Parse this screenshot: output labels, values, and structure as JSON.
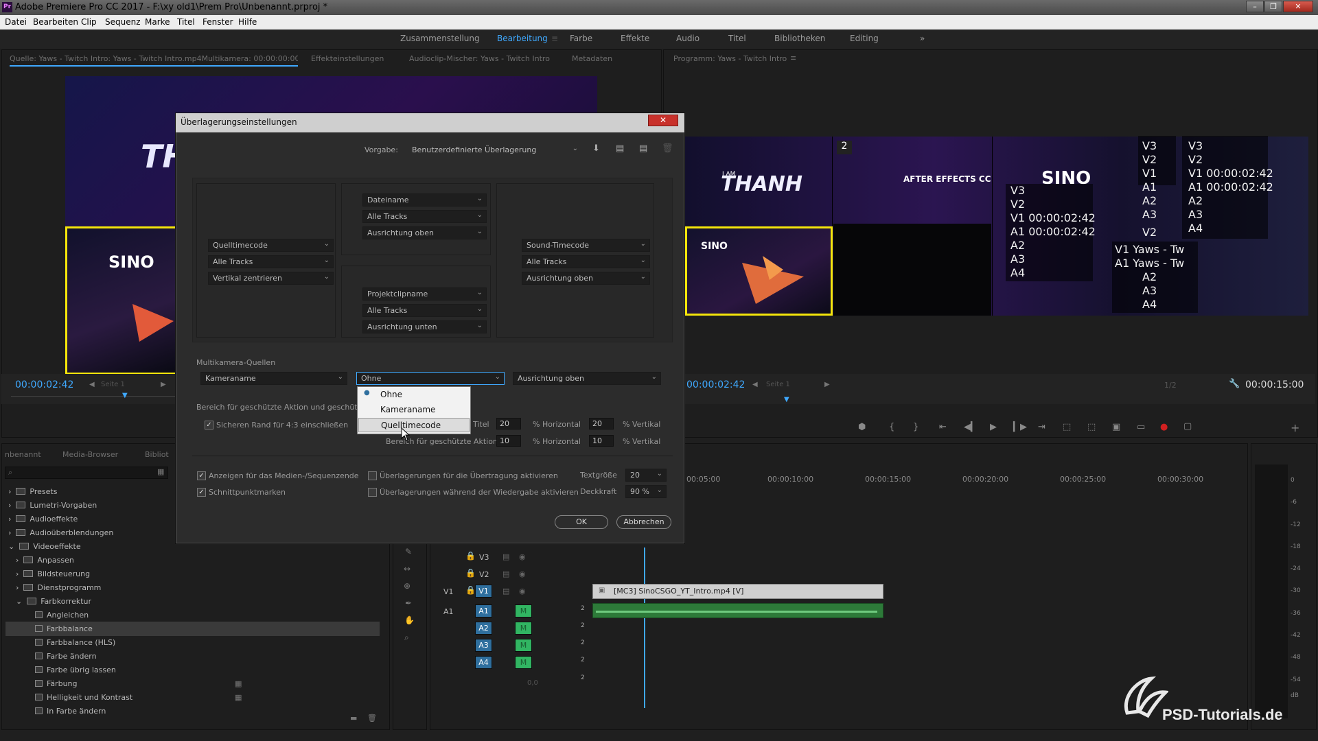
{
  "app": {
    "title": "Adobe Premiere Pro CC 2017 - F:\\xy old1\\Prem Pro\\Unbenannt.prproj *",
    "logo": "Pr"
  },
  "menu": [
    "Datei",
    "Bearbeiten",
    "Clip",
    "Sequenz",
    "Marke",
    "Titel",
    "Fenster",
    "Hilfe"
  ],
  "workspaces": [
    "Zusammenstellung",
    "Bearbeitung",
    "Farbe",
    "Effekte",
    "Audio",
    "Titel",
    "Bibliotheken",
    "Editing"
  ],
  "source_tabs": [
    "Quelle: Yaws - Twitch Intro: Yaws - Twitch Intro.mp4Multikamera: 00:00:00:00",
    "Effekteinstellungen",
    "Audioclip-Mischer: Yaws - Twitch Intro",
    "Metadaten"
  ],
  "program_tab": "Programm: Yaws - Twitch Intro",
  "source_timecode": "00:00:02:42",
  "source_page": "Seite 1",
  "program_timecode": "00:00:02:42",
  "program_page": "Seite 1",
  "program_zoom": "1/2",
  "program_duration": "00:00:15:00",
  "program_cam_number": "2",
  "program_overlay": {
    "col1": [
      "V3",
      "V2",
      "V1 00:00:02:42",
      "A1 00:00:02:42",
      "A2",
      "A3",
      "A4"
    ],
    "col2": [
      "V3",
      "V2",
      "V1",
      "A1",
      "A2",
      "A3",
      "V2",
      "V1 Yaws - Tw",
      "A1 Yaws - Tw",
      "A2",
      "A3",
      "A4"
    ],
    "col3": [
      "V3",
      "V2",
      "V1 00:00:02:42",
      "A1 00:00:02:42",
      "A2",
      "A3",
      "A4"
    ]
  },
  "video_texts": {
    "thanh_top": "I AM",
    "thanh": "THANH",
    "ae": "AFTER EFFECTS CC",
    "sino": "SINO",
    "th": "TH",
    "sino_source": "SINO"
  },
  "dialog": {
    "title": "Überlagerungseinstellungen",
    "close": "✕",
    "preset_label": "Vorgabe:",
    "preset_value": "Benutzerdefinierte Überlagerung",
    "top_center": [
      "Dateiname",
      "Alle Tracks",
      "Ausrichtung oben"
    ],
    "mid_left": [
      "Quelltimecode",
      "Alle Tracks",
      "Vertikal zentrieren"
    ],
    "mid_right": [
      "Sound-Timecode",
      "Alle Tracks",
      "Ausrichtung oben"
    ],
    "bottom_center": [
      "Projektclipname",
      "Alle Tracks",
      "Ausrichtung unten"
    ],
    "multicam_label": "Multikamera-Quellen",
    "multicam": [
      "Kameraname",
      "Ohne",
      "Ausrichtung oben"
    ],
    "dropdown_options": [
      "Ohne",
      "Kameraname",
      "Quelltimecode"
    ],
    "dropdown_selected": "Ohne",
    "dropdown_hover": "Quelltimecode",
    "safe_area_label": "Bereich für geschützte Aktion und geschützten",
    "safe_margin_label": "Sicheren Rand für 4:3 einschließen",
    "title_label": "Titel",
    "title_h": "20",
    "title_v": "20",
    "action_label": "Bereich für geschützte Aktion",
    "action_h": "10",
    "action_v": "10",
    "pct_h": "% Horizontal",
    "pct_v": "% Vertikal",
    "show_media_end": "Anzeigen für das Medien-/Sequenzende",
    "cut_marks": "Schnittpunktmarken",
    "enable_transmit": "Überlagerungen für die Übertragung aktivieren",
    "enable_playback": "Überlagerungen während der Wiedergabe aktivieren",
    "text_size_label": "Textgröße",
    "text_size": "20",
    "opacity_label": "Deckkraft",
    "opacity": "90 %",
    "ok": "OK",
    "cancel": "Abbrechen"
  },
  "project_tabs": [
    "nbenannt",
    "Media-Browser",
    "Bibliot"
  ],
  "effects_tree": [
    {
      "label": "Presets",
      "level": 0
    },
    {
      "label": "Lumetri-Vorgaben",
      "level": 0
    },
    {
      "label": "Audioeffekte",
      "level": 0
    },
    {
      "label": "Audioüberblendungen",
      "level": 0
    },
    {
      "label": "Videoeffekte",
      "level": 0
    },
    {
      "label": "Anpassen",
      "level": 1
    },
    {
      "label": "Bildsteuerung",
      "level": 1
    },
    {
      "label": "Dienstprogramm",
      "level": 1
    },
    {
      "label": "Farbkorrektur",
      "level": 1
    },
    {
      "label": "Angleichen",
      "level": 2
    },
    {
      "label": "Farbbalance",
      "level": 2
    },
    {
      "label": "Farbbalance (HLS)",
      "level": 2
    },
    {
      "label": "Farbe ändern",
      "level": 2
    },
    {
      "label": "Farbe übrig lassen",
      "level": 2
    },
    {
      "label": "Färbung",
      "level": 2
    },
    {
      "label": "Helligkeit und Kontrast",
      "level": 2
    },
    {
      "label": "In Farbe ändern",
      "level": 2
    }
  ],
  "timeline": {
    "ruler": [
      "00:05:00",
      "00:00:10:00",
      "00:00:15:00",
      "00:00:20:00",
      "00:00:25:00",
      "00:00:30:00"
    ],
    "video_tracks": [
      "V3",
      "V2",
      "V1"
    ],
    "audio_tracks": [
      "A1",
      "A2",
      "A3",
      "A4"
    ],
    "src_v": "V1",
    "src_a": "A1",
    "clip_video": "[MC3] SinoCSGO_YT_Intro.mp4 [V]",
    "mix_value": "0,0",
    "track_nums": [
      "2",
      "2",
      "2",
      "2",
      "2"
    ]
  },
  "meter_labels": [
    "0",
    "-6",
    "-12",
    "-18",
    "-24",
    "-30",
    "-36",
    "-42",
    "-48",
    "-54",
    "dB"
  ],
  "watermark": "PSD-Tutorials.de",
  "colors": {
    "accent": "#3fa9ff",
    "yellow": "#f5e60a",
    "track_blue": "#2f6f9e",
    "green": "#31b562",
    "close_red": "#c8312b"
  }
}
